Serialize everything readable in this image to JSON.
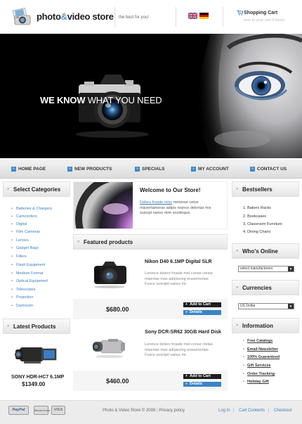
{
  "header": {
    "logo_brand": "photo",
    "logo_amp": "&",
    "logo_rest": "video store",
    "tagline": "the best for you!",
    "cart_title": "Shopping Cart",
    "cart_subtitle": "now in your cart 0 items",
    "languages": [
      "english-flag-icon",
      "german-flag-icon"
    ]
  },
  "banner": {
    "headline_bold": "WE KNOW",
    "headline_rest": " WHAT YOU NEED"
  },
  "nav": {
    "items": [
      "HOME PAGE",
      "NEW PRODUCTS",
      "SPECIALS",
      "MY ACCOUNT",
      "CONTACT US"
    ]
  },
  "categories": {
    "title": "Select Categories",
    "items": [
      "Batteries & Chargers",
      "Camcorders",
      "Digital",
      "Film Cameras",
      "Lenses",
      "Gadget Bags",
      "Filters",
      "Flash Equipment",
      "Medium Format",
      "Optical Equipment",
      "Telescopes",
      "Projection",
      "Darkroom"
    ]
  },
  "latest": {
    "title": "Latest Products",
    "product_name": "SONY HDR-HC7 6.1MP",
    "product_price": "$1349.00"
  },
  "welcome": {
    "title": "Welcome to Our Store!",
    "text_link": "Delero froade mixs",
    "text_rest_1": " metonse cetue",
    "text_line_2": "misxertameras adipis nrance delortas mis",
    "text_line_3": "suscipt varius mim sociitoque."
  },
  "featured": {
    "title": "Featured products",
    "products": [
      {
        "name": "Nikon D40 6.1MP Digital SLR",
        "desc_1": "Lorence delero froade met conse ctetue",
        "desc_2": "misertas mas adipiscing erasemortas",
        "desc_3": "Fusce suscipit varius mi.",
        "price": "$680.00",
        "add_label": "Add to Cart",
        "details_label": "Details"
      },
      {
        "name": "Sony DCR-SR62 30GB Hard Disk",
        "desc_1": "Lorence delero froade met conse ctetue",
        "desc_2": "misertas mas adipiscing erasemortas",
        "desc_3": "Fusce suscipit varius mi.",
        "price": "$460.00",
        "add_label": "Add to Cart",
        "details_label": "Details"
      }
    ]
  },
  "bestsellers": {
    "title": "Bestsellers",
    "items": [
      "Bakers Racks",
      "Bookcases",
      "Classroom Furniture",
      "Dining Chairs"
    ]
  },
  "whos_online": {
    "title": "Who's Online",
    "select_value": "select manufacturers"
  },
  "currencies": {
    "title": "Currencies",
    "select_value": "US Dollar"
  },
  "information": {
    "title": "Information",
    "items": [
      "Free Catalogs",
      "Email Newsletter",
      "100% Guaranteed",
      "Gift Services",
      "Order Tracking",
      "Holiday Gift"
    ]
  },
  "footer": {
    "payments": [
      "PayPal",
      "MasterCard",
      "VISA"
    ],
    "copyright": "Photo & Video Store © 2008",
    "privacy": "Privacy policy",
    "links": [
      "Log In",
      "Cart Contents",
      "Checkout"
    ]
  },
  "colors": {
    "accent": "#3a84c6",
    "link": "#3c7fc0",
    "dark": "#1e1e1e"
  }
}
